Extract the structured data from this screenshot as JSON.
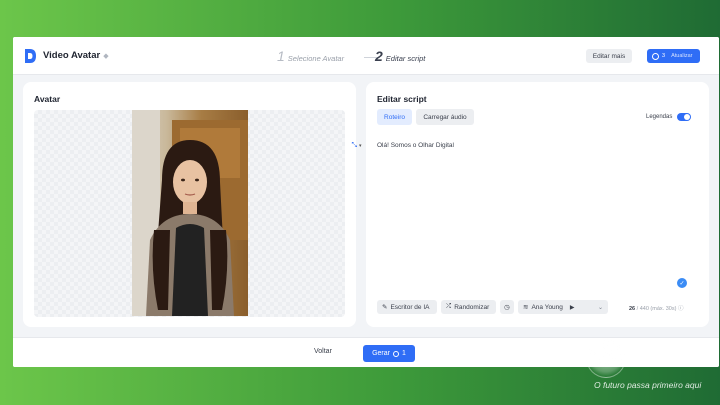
{
  "header": {
    "title": "Video Avatar",
    "steps": [
      {
        "num": "1",
        "label": "Selecione Avatar"
      },
      {
        "num": "2",
        "label": "Editar script"
      }
    ],
    "edit_more": "Editar mais",
    "upgrade": {
      "count": "3",
      "label": "Atualizar"
    }
  },
  "avatar_panel": {
    "title": "Avatar"
  },
  "script_panel": {
    "title": "Editar script",
    "tabs": [
      "Roteiro",
      "Carregar áudio"
    ],
    "legendas_label": "Legendas",
    "legendas_on": true,
    "script_text": "Olá! Somos o Olhar Digital",
    "tools": {
      "writer": "Escritor de IA",
      "randomize": "Randomizar",
      "voice": "Ana Young"
    },
    "counter": {
      "current": "26",
      "rest": "/ 440 (máx. 30s)"
    }
  },
  "footer": {
    "back": "Voltar",
    "generate": "Gerar",
    "generate_suffix": "1"
  },
  "watermark": {
    "brand": "DIGITAL",
    "slogan": "O futuro passa primeiro aqui"
  },
  "colors": {
    "accent": "#2f6df6",
    "background_gradient": [
      "#6cc64a",
      "#1f6b34"
    ]
  }
}
